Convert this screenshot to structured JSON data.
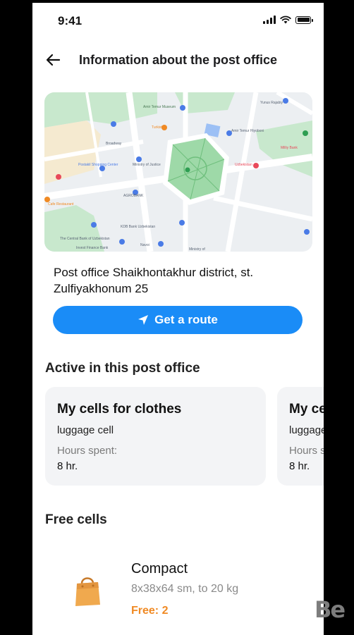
{
  "status": {
    "time": "9:41",
    "icons": [
      "signal-icon",
      "wifi-icon",
      "battery-icon"
    ]
  },
  "header": {
    "title": "Information about the post office",
    "back_icon": "arrow-left-icon"
  },
  "map": {
    "labels": {
      "amir_temur": "Amir Temur Museum",
      "yunus": "Yunus Rajabiy",
      "broadway": "Broadway",
      "uzbekistan": "Uzbekistan",
      "ministry": "Ministry of Justice",
      "postakil": "Postakil Shopping Center",
      "agrobank": "AGROBANK",
      "kdb": "KDB Bank Uzbekistan",
      "central_bank": "The Central Bank of Uzbekistan",
      "invest": "Invest Finance Bank",
      "navoi": "Navoi",
      "cafe": "Cafe Restaurant",
      "amir_hiyobon": "Amir Temur Hiyoboni",
      "turkiston": "Turkiston",
      "ministry2": "Ministry of",
      "milliy": "Milliy Bank"
    }
  },
  "address": "Post office Shaikhontakhur district, st. Zulfiyakhonum 25",
  "route_button": {
    "label": "Get a route",
    "icon": "navigation-arrow-icon"
  },
  "active_section": {
    "title": "Active in this post office",
    "cards": [
      {
        "title": "My cells for clothes",
        "type": "luggage cell",
        "hours_label": "Hours spent:",
        "hours_value": "8 hr."
      },
      {
        "title": "My cells for clothes",
        "type": "luggage cell",
        "hours_label": "Hours spent:",
        "hours_value": "8 hr."
      }
    ]
  },
  "free_section": {
    "title": "Free cells",
    "cells": [
      {
        "name": "Compact",
        "size": "8x38x64 sm, to 20 kg",
        "free": "Free: 2",
        "icon": "shopping-bag-icon"
      }
    ]
  },
  "watermark": {
    "text": "Be",
    "icon": "behance-logo-icon"
  },
  "colors": {
    "accent": "#1a8cf7",
    "free": "#f08a24",
    "card_bg": "#f3f4f6",
    "map_park": "#9ed9a8"
  }
}
